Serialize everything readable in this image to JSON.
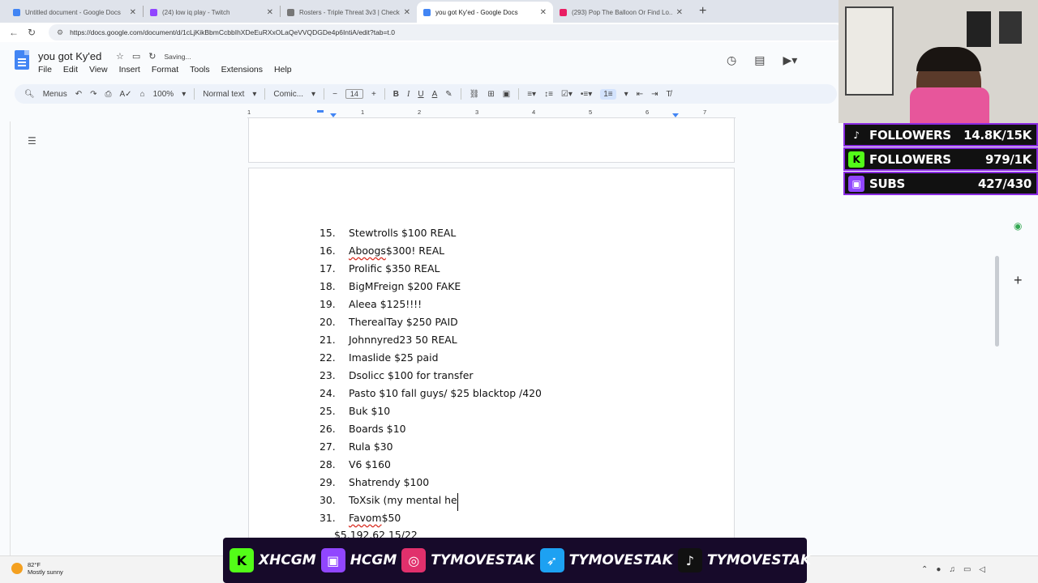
{
  "browser": {
    "tabs": [
      {
        "title": "Untitled document - Google Docs",
        "color": "#4285f4",
        "active": false
      },
      {
        "title": "(24) low iq play - Twitch",
        "color": "#9146ff",
        "active": false
      },
      {
        "title": "Rosters - Triple Threat 3v3 | Check",
        "color": "#777777",
        "active": false
      },
      {
        "title": "you got Ky'ed - Google Docs",
        "color": "#4285f4",
        "active": true
      },
      {
        "title": "(293) Pop The Balloon Or Find Lo...",
        "color": "#e91e63",
        "active": false
      }
    ],
    "url": "https://docs.google.com/document/d/1cLjKikBbmCcbbIhXDeEuRXxOLaQeVVQDGDe4p6IntiA/edit?tab=t.0"
  },
  "doc": {
    "title": "you got Ky'ed",
    "status": "Saving...",
    "menu": [
      "File",
      "Edit",
      "View",
      "Insert",
      "Format",
      "Tools",
      "Extensions",
      "Help"
    ]
  },
  "toolbar": {
    "menus": "Menus",
    "zoom": "100%",
    "style": "Normal text",
    "font": "Comic...",
    "size": "14"
  },
  "ruler": [
    "1",
    "1",
    "2",
    "3",
    "4",
    "5",
    "6",
    "7"
  ],
  "list": [
    {
      "num": "15.",
      "pre": "",
      "sq": "",
      "post": "Stewtrolls $100 REAL"
    },
    {
      "num": "16.",
      "pre": "",
      "sq": "Aboogs",
      "post": " $300! REAL"
    },
    {
      "num": "17.",
      "pre": "",
      "sq": "",
      "post": "Prolific $350 REAL"
    },
    {
      "num": "18.",
      "pre": "",
      "sq": "",
      "post": "BigMFreign $200 FAKE"
    },
    {
      "num": "19.",
      "pre": "",
      "sq": "",
      "post": "Aleea $125!!!!"
    },
    {
      "num": "20.",
      "pre": "",
      "sq": "",
      "post": "TherealTay $250 PAID"
    },
    {
      "num": "21.",
      "pre": "",
      "sq": "",
      "post": "Johnnyred23 50 REAL"
    },
    {
      "num": "22.",
      "pre": "",
      "sq": "",
      "post": "Imaslide $25 paid"
    },
    {
      "num": "23.",
      "pre": "",
      "sq": "",
      "post": "Dsolicc $100 for transfer"
    },
    {
      "num": "24.",
      "pre": "",
      "sq": "",
      "post": "Pasto $10 fall guys/ $25 blacktop /420"
    },
    {
      "num": "25.",
      "pre": "",
      "sq": "",
      "post": "Buk $10"
    },
    {
      "num": "26.",
      "pre": "",
      "sq": "",
      "post": "Boards $10"
    },
    {
      "num": "27.",
      "pre": "",
      "sq": "",
      "post": "Rula $30"
    },
    {
      "num": "28.",
      "pre": "",
      "sq": "",
      "post": "V6 $160"
    },
    {
      "num": "29.",
      "pre": "",
      "sq": "",
      "post": "Shatrendy $100"
    },
    {
      "num": "30.",
      "pre": "",
      "sq": "",
      "post": "ToXsik (my mental he"
    },
    {
      "num": "31.",
      "pre": "",
      "sq": "Favom",
      "post": " $50"
    }
  ],
  "total": "$5,192.62 15/22",
  "overlay": {
    "stats": [
      {
        "label": "FOLLOWERS",
        "value": "14.8K/15K",
        "icon": "tiktok-icon",
        "color": "#111111"
      },
      {
        "label": "FOLLOWERS",
        "value": "979/1K",
        "icon": "kick-icon",
        "color": "#53fc18"
      },
      {
        "label": "SUBS",
        "value": "427/430",
        "icon": "twitch-icon",
        "color": "#9146ff"
      }
    ],
    "banner": [
      {
        "handle": "XHCGM",
        "icon": "kick-icon",
        "color": "#53fc18"
      },
      {
        "handle": "HCGM",
        "icon": "twitch-icon",
        "color": "#9146ff"
      },
      {
        "handle": "TYMOVESTAK",
        "icon": "instagram-icon",
        "color": "#e1306c"
      },
      {
        "handle": "TYMOVESTAK",
        "icon": "twitter-icon",
        "color": "#1da1f2"
      },
      {
        "handle": "TYMOVESTAK",
        "icon": "tiktok-icon",
        "color": "#111111"
      }
    ]
  },
  "taskbar": {
    "temp": "82°F",
    "weather": "Mostly sunny"
  }
}
